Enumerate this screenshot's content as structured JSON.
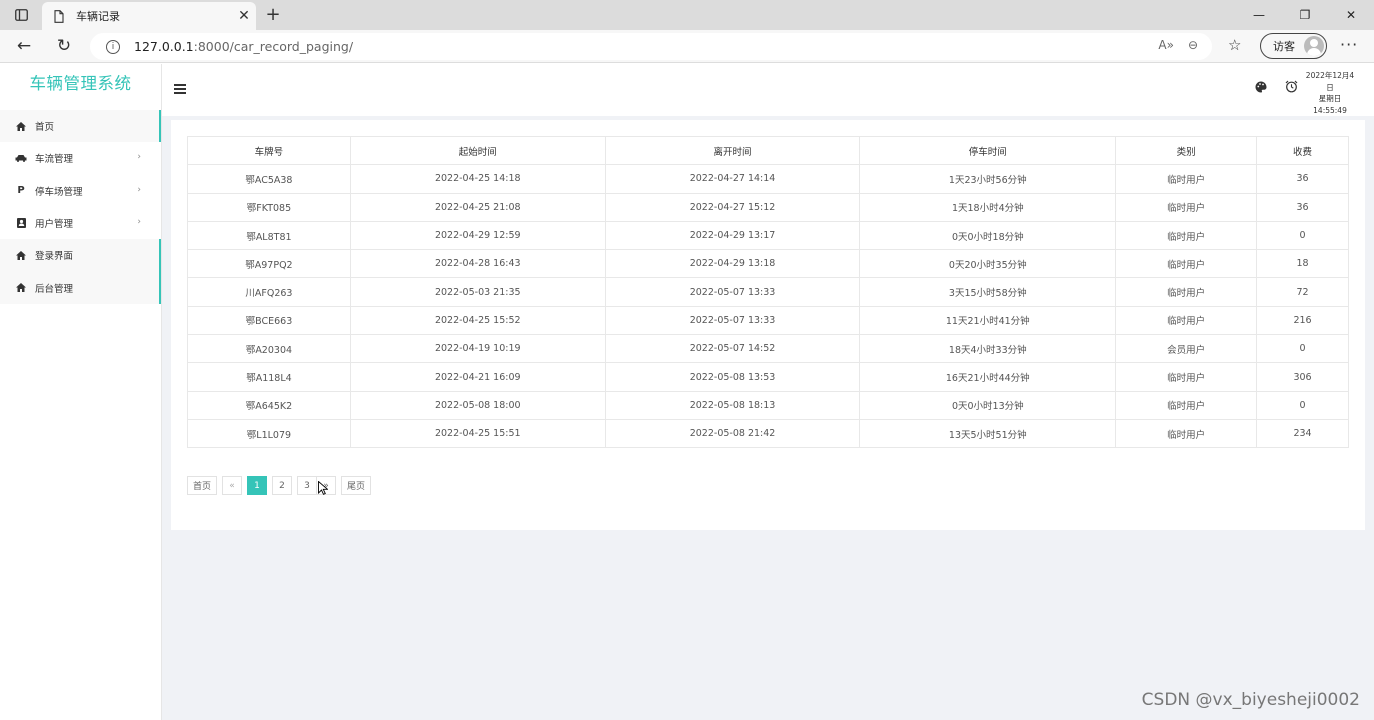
{
  "browser": {
    "tab_title": "车辆记录",
    "url_host": "127.0.0.1",
    "url_path": ":8000/car_record_paging/",
    "profile_label": "访客"
  },
  "sidebar": {
    "brand": "车辆管理系统",
    "items": [
      {
        "label": "首页",
        "icon": "home-icon"
      },
      {
        "label": "车流管理",
        "icon": "car-icon"
      },
      {
        "label": "停车场管理",
        "icon": "parking-icon"
      },
      {
        "label": "用户管理",
        "icon": "user-icon"
      },
      {
        "label": "登录界面",
        "icon": "home-icon"
      },
      {
        "label": "后台管理",
        "icon": "home-icon"
      }
    ]
  },
  "header": {
    "date": "2022年12月4日",
    "weekday": "星期日",
    "time": "14:55:49"
  },
  "table": {
    "columns": [
      "车牌号",
      "起始时间",
      "离开时间",
      "停车时间",
      "类别",
      "收费"
    ],
    "rows": [
      [
        "鄂AC5A38",
        "2022-04-25 14:18",
        "2022-04-27 14:14",
        "1天23小时56分钟",
        "临时用户",
        "36"
      ],
      [
        "鄂FKT085",
        "2022-04-25 21:08",
        "2022-04-27 15:12",
        "1天18小时4分钟",
        "临时用户",
        "36"
      ],
      [
        "鄂AL8T81",
        "2022-04-29 12:59",
        "2022-04-29 13:17",
        "0天0小时18分钟",
        "临时用户",
        "0"
      ],
      [
        "鄂A97PQ2",
        "2022-04-28 16:43",
        "2022-04-29 13:18",
        "0天20小时35分钟",
        "临时用户",
        "18"
      ],
      [
        "川AFQ263",
        "2022-05-03 21:35",
        "2022-05-07 13:33",
        "3天15小时58分钟",
        "临时用户",
        "72"
      ],
      [
        "鄂BCE663",
        "2022-04-25 15:52",
        "2022-05-07 13:33",
        "11天21小时41分钟",
        "临时用户",
        "216"
      ],
      [
        "鄂A20304",
        "2022-04-19 10:19",
        "2022-05-07 14:52",
        "18天4小时33分钟",
        "会员用户",
        "0"
      ],
      [
        "鄂A118L4",
        "2022-04-21 16:09",
        "2022-05-08 13:53",
        "16天21小时44分钟",
        "临时用户",
        "306"
      ],
      [
        "鄂A645K2",
        "2022-05-08 18:00",
        "2022-05-08 18:13",
        "0天0小时13分钟",
        "临时用户",
        "0"
      ],
      [
        "鄂L1L079",
        "2022-04-25 15:51",
        "2022-05-08 21:42",
        "13天5小时51分钟",
        "临时用户",
        "234"
      ]
    ]
  },
  "pagination": {
    "first": "首页",
    "prev": "«",
    "pages": [
      "1",
      "2",
      "3"
    ],
    "next": "»",
    "last": "尾页",
    "current": "1"
  },
  "watermark": "CSDN @vx_biyesheji0002",
  "colors": {
    "accent": "#35c4b8",
    "background": "#f0f2f6"
  }
}
